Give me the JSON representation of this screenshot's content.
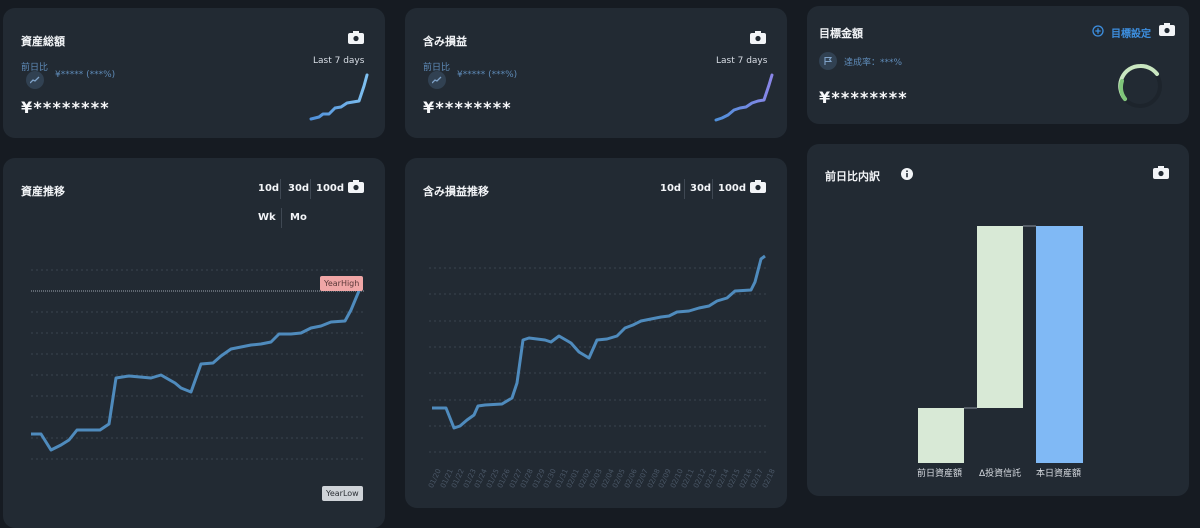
{
  "cards": {
    "total_assets": {
      "title": "資産総額",
      "compare_label": "前日比",
      "compare_value": "¥***** (***%)",
      "amount": "¥********",
      "spark_label": "Last 7 days"
    },
    "unrealized": {
      "title": "含み損益",
      "compare_label": "前日比",
      "compare_value": "¥***** (***%)",
      "amount": "¥********",
      "spark_label": "Last 7 days"
    },
    "target": {
      "title": "目標金額",
      "set_label": "目標設定",
      "rate_label": "達成率：***%",
      "amount": "¥********"
    },
    "asset_trend": {
      "title": "資産推移",
      "ranges": [
        "10d",
        "30d",
        "100d"
      ],
      "ranges2": [
        "Wk",
        "Mo"
      ],
      "year_high": "YearHigh",
      "year_low": "YearLow"
    },
    "pl_trend": {
      "title": "含み損益推移",
      "ranges": [
        "10d",
        "30d",
        "100d"
      ],
      "x_labels": [
        "01/20",
        "01/21",
        "01/22",
        "01/23",
        "01/24",
        "01/25",
        "01/26",
        "01/27",
        "01/28",
        "01/29",
        "01/30",
        "01/31",
        "02/01",
        "02/02",
        "02/03",
        "02/04",
        "02/05",
        "02/06",
        "02/07",
        "02/08",
        "02/09",
        "02/10",
        "02/11",
        "02/12",
        "02/13",
        "02/14",
        "02/15",
        "02/16",
        "02/17",
        "02/18"
      ]
    },
    "breakdown": {
      "title": "前日比内訳",
      "labels": [
        "前日資産額",
        "Δ投資信託",
        "本日資産額"
      ],
      "colors": [
        "#d8e9d6",
        "#d8e9d6",
        "#80b9f5"
      ]
    }
  },
  "colors": {
    "line": "#4f8bbd",
    "accent_blue": "#3d8fe0"
  }
}
